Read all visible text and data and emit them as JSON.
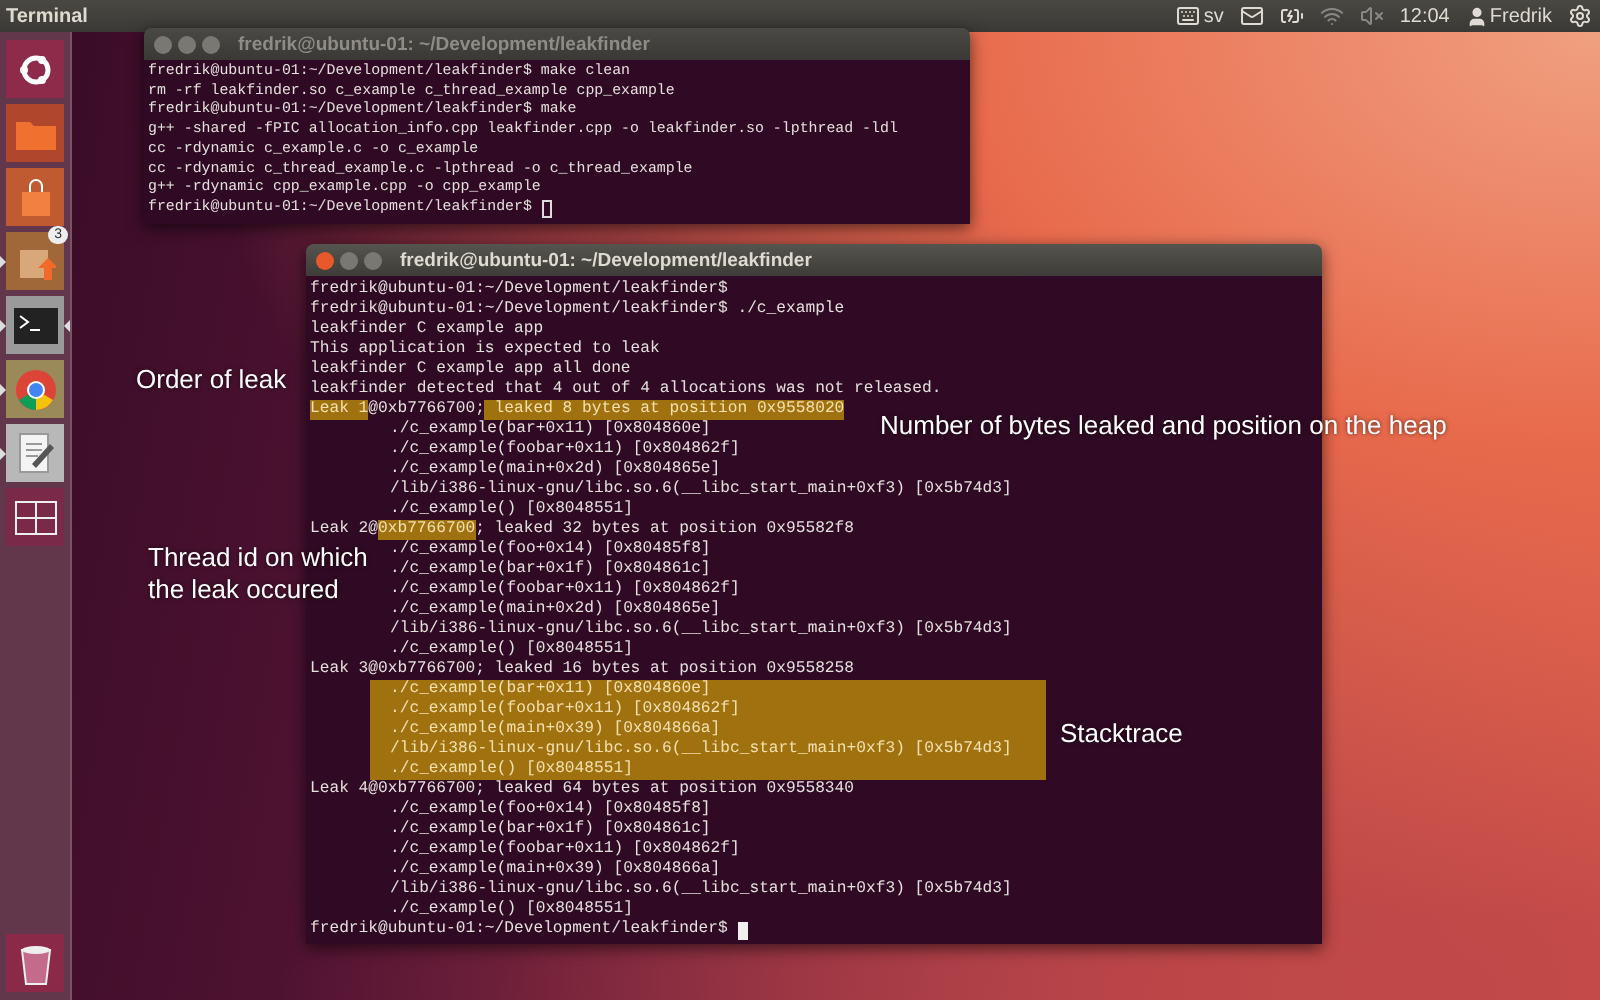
{
  "top_bar": {
    "app_title": "Terminal",
    "keyboard_layout": "sv",
    "clock": "12:04",
    "user": "Fredrik"
  },
  "launcher": {
    "items": [
      {
        "kind": "dash",
        "running": false,
        "focused": false
      },
      {
        "kind": "files",
        "running": false,
        "focused": false
      },
      {
        "kind": "store",
        "running": false,
        "focused": false
      },
      {
        "kind": "updates",
        "running": true,
        "focused": false,
        "badge": "3"
      },
      {
        "kind": "terminal",
        "running": true,
        "focused": true
      },
      {
        "kind": "browser",
        "running": true,
        "focused": false
      },
      {
        "kind": "editor",
        "running": true,
        "focused": false
      },
      {
        "kind": "workspaces",
        "running": false,
        "focused": false
      },
      {
        "kind": "trash",
        "running": false,
        "focused": false
      }
    ]
  },
  "windows": [
    {
      "title": "fredrik@ubuntu-01: ~/Development/leakfinder",
      "active": false,
      "lines": [
        {
          "kind": "plain",
          "text": "fredrik@ubuntu-01:~/Development/leakfinder$ make clean"
        },
        {
          "kind": "plain",
          "text": "rm -rf leakfinder.so c_example c_thread_example cpp_example"
        },
        {
          "kind": "plain",
          "text": "fredrik@ubuntu-01:~/Development/leakfinder$ make"
        },
        {
          "kind": "plain",
          "text": "g++ -shared -fPIC allocation_info.cpp leakfinder.cpp -o leakfinder.so -lpthread -ldl"
        },
        {
          "kind": "plain",
          "text": "cc -rdynamic c_example.c -o c_example"
        },
        {
          "kind": "plain",
          "text": "cc -rdynamic c_thread_example.c -lpthread -o c_thread_example"
        },
        {
          "kind": "plain",
          "text": "g++ -rdynamic cpp_example.cpp -o cpp_example"
        },
        {
          "kind": "input",
          "text": "fredrik@ubuntu-01:~/Development/leakfinder$"
        }
      ]
    },
    {
      "title": "fredrik@ubuntu-01: ~/Development/leakfinder",
      "active": true,
      "lines": [
        {
          "kind": "plain",
          "text": "fredrik@ubuntu-01:~/Development/leakfinder$"
        },
        {
          "kind": "plain",
          "text": "fredrik@ubuntu-01:~/Development/leakfinder$ ./c_example"
        },
        {
          "kind": "plain",
          "text": "leakfinder C example app"
        },
        {
          "kind": "plain",
          "text": "This application is expected to leak"
        },
        {
          "kind": "plain",
          "text": "leakfinder C example app all done"
        },
        {
          "kind": "plain",
          "text": "leakfinder detected that 4 out of 4 allocations was not released."
        },
        {
          "kind": "leak",
          "segments": [
            {
              "text": "Leak 1",
              "highlighted": true
            },
            {
              "text": "@0xb7766700;",
              "highlighted": false
            },
            {
              "text": " leaked 8 bytes at position 0x9558020",
              "highlighted": true
            }
          ]
        },
        {
          "kind": "frame",
          "text": "./c_example(bar+0x11) [0x804860e]",
          "highlighted": false
        },
        {
          "kind": "frame",
          "text": "./c_example(foobar+0x11) [0x804862f]",
          "highlighted": false
        },
        {
          "kind": "frame",
          "text": "./c_example(main+0x2d) [0x804865e]",
          "highlighted": false
        },
        {
          "kind": "frame",
          "text": "/lib/i386-linux-gnu/libc.so.6(__libc_start_main+0xf3) [0x5b74d3]",
          "highlighted": false
        },
        {
          "kind": "frame",
          "text": "./c_example() [0x8048551]",
          "highlighted": false
        },
        {
          "kind": "leak",
          "segments": [
            {
              "text": "Leak 2@",
              "highlighted": false
            },
            {
              "text": "0xb7766700",
              "highlighted": true
            },
            {
              "text": "; leaked 32 bytes at position 0x95582f8",
              "highlighted": false
            }
          ]
        },
        {
          "kind": "frame",
          "text": "./c_example(foo+0x14) [0x80485f8]",
          "highlighted": false
        },
        {
          "kind": "frame",
          "text": "./c_example(bar+0x1f) [0x804861c]",
          "highlighted": false
        },
        {
          "kind": "frame",
          "text": "./c_example(foobar+0x11) [0x804862f]",
          "highlighted": false
        },
        {
          "kind": "frame",
          "text": "./c_example(main+0x2d) [0x804865e]",
          "highlighted": false
        },
        {
          "kind": "frame",
          "text": "/lib/i386-linux-gnu/libc.so.6(__libc_start_main+0xf3) [0x5b74d3]",
          "highlighted": false
        },
        {
          "kind": "frame",
          "text": "./c_example() [0x8048551]",
          "highlighted": false
        },
        {
          "kind": "leak",
          "segments": [
            {
              "text": "Leak 3@0xb7766700; leaked 16 bytes at position 0x9558258",
              "highlighted": false
            }
          ]
        },
        {
          "kind": "frame",
          "text": "./c_example(bar+0x11) [0x804860e]",
          "highlighted": true
        },
        {
          "kind": "frame",
          "text": "./c_example(foobar+0x11) [0x804862f]",
          "highlighted": true
        },
        {
          "kind": "frame",
          "text": "./c_example(main+0x39) [0x804866a]",
          "highlighted": true
        },
        {
          "kind": "frame",
          "text": "/lib/i386-linux-gnu/libc.so.6(__libc_start_main+0xf3) [0x5b74d3]",
          "highlighted": true
        },
        {
          "kind": "frame",
          "text": "./c_example() [0x8048551]",
          "highlighted": true
        },
        {
          "kind": "leak",
          "segments": [
            {
              "text": "Leak 4@0xb7766700; leaked 64 bytes at position 0x9558340",
              "highlighted": false
            }
          ]
        },
        {
          "kind": "frame",
          "text": "./c_example(foo+0x14) [0x80485f8]",
          "highlighted": false
        },
        {
          "kind": "frame",
          "text": "./c_example(bar+0x1f) [0x804861c]",
          "highlighted": false
        },
        {
          "kind": "frame",
          "text": "./c_example(foobar+0x11) [0x804862f]",
          "highlighted": false
        },
        {
          "kind": "frame",
          "text": "./c_example(main+0x39) [0x804866a]",
          "highlighted": false
        },
        {
          "kind": "frame",
          "text": "/lib/i386-linux-gnu/libc.so.6(__libc_start_main+0xf3) [0x5b74d3]",
          "highlighted": false
        },
        {
          "kind": "frame",
          "text": "./c_example() [0x8048551]",
          "highlighted": false
        },
        {
          "kind": "input",
          "text": "fredrik@ubuntu-01:~/Development/leakfinder$"
        }
      ]
    }
  ],
  "annotations": [
    {
      "text": "Order of leak"
    },
    {
      "text": "Number of bytes leaked and position on the heap"
    },
    {
      "text": "Thread id on which the leak occured"
    },
    {
      "text": "Stacktrace"
    }
  ]
}
